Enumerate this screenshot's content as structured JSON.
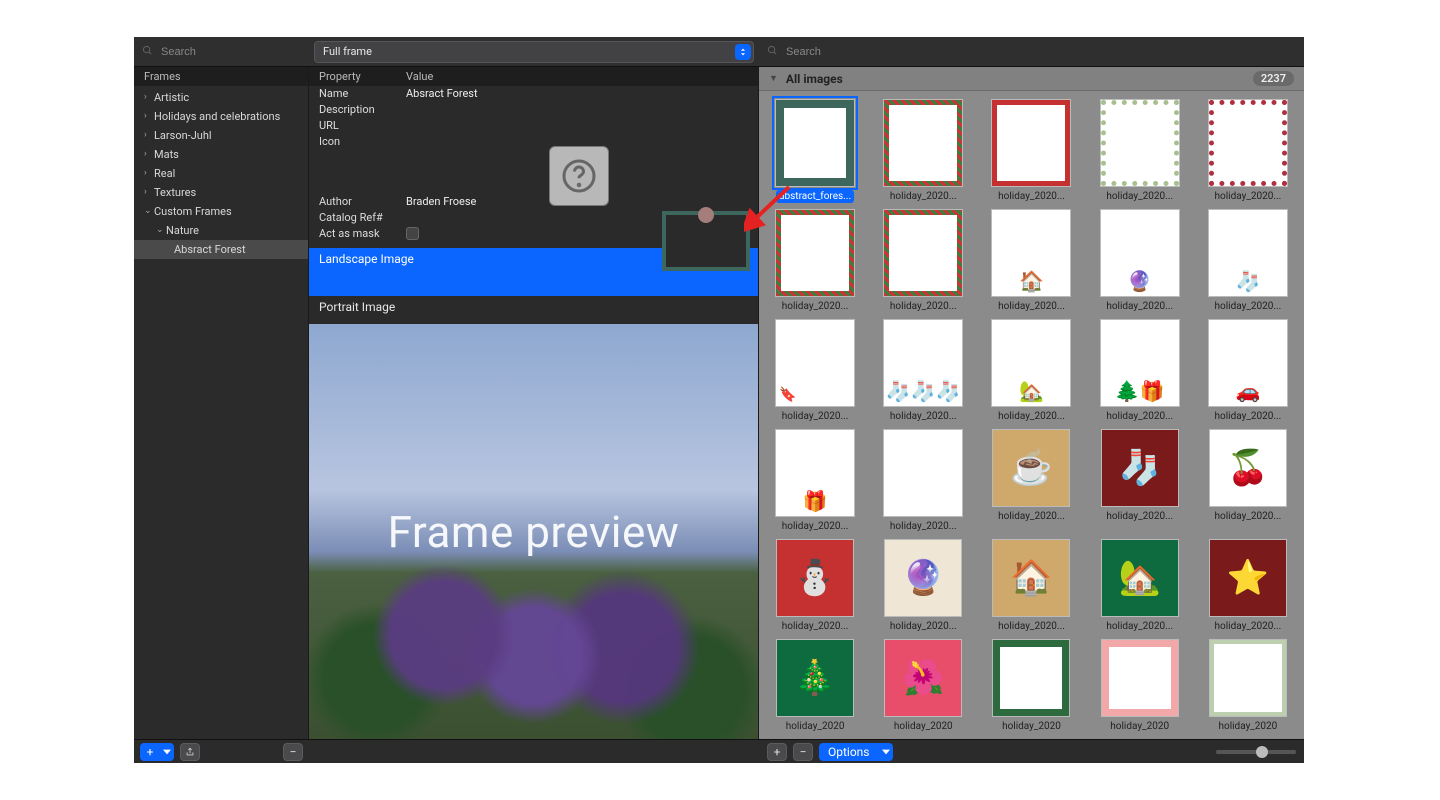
{
  "sidebar_search": {
    "placeholder": "Search"
  },
  "dropdown": {
    "label": "Full frame"
  },
  "right_search": {
    "placeholder": "Search"
  },
  "sidebar": {
    "header": "Frames",
    "items": [
      {
        "label": "Artistic"
      },
      {
        "label": "Holidays and celebrations"
      },
      {
        "label": "Larson-Juhl"
      },
      {
        "label": "Mats"
      },
      {
        "label": "Real"
      },
      {
        "label": "Textures"
      }
    ],
    "custom": {
      "label": "Custom Frames",
      "child": "Nature",
      "leaf": "Absract Forest"
    }
  },
  "props": {
    "head_prop": "Property",
    "head_val": "Value",
    "name_label": "Name",
    "name_value": "Absract Forest",
    "desc_label": "Description",
    "url_label": "URL",
    "icon_label": "Icon",
    "author_label": "Author",
    "author_value": "Braden Froese",
    "catalog_label": "Catalog Ref#",
    "mask_label": "Act as mask",
    "landscape_label": "Landscape Image",
    "portrait_label": "Portrait Image"
  },
  "preview": {
    "text": "Frame preview"
  },
  "right": {
    "header": "All images",
    "count": "2237"
  },
  "thumbs": {
    "t0": "abstract_fores...",
    "gen": "holiday_2020...",
    "gen2": "holiday_2020"
  },
  "bottombar": {
    "options": "Options"
  }
}
